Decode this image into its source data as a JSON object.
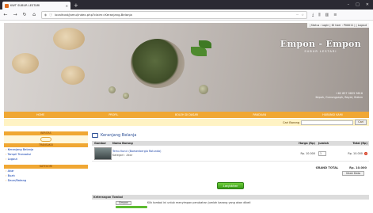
{
  "browser": {
    "tab_title": "KWT SUBUR LESTARI",
    "url": "localhost/jamu/index.php?claim=Keranjang-Belanja",
    "new_tab": "+"
  },
  "header": {
    "status": "| Status : Login | ID User : P00011 | | Logout",
    "brand_name": "Empon - Empon",
    "brand_sub": "SUBUR LESTARI",
    "phone": "+62 857 0825 9616",
    "address": "Kepoh, Gunungpaph, Bayat, Klaten"
  },
  "nav": [
    "HOME",
    "PROFIL",
    "BOLEH DI DASAR",
    "PANDUAN",
    "HUBUNGI KAMI"
  ],
  "cart_search": {
    "label": "Cari Barang",
    "button": "Cari"
  },
  "sidebar": {
    "head1": "BERITAS",
    "head2": "TRANSAKSI",
    "links1": [
      "Keranjang Belanja",
      "Tampil Transaksi",
      "Logout"
    ],
    "head3": "KATEGORI",
    "links2": [
      "Akar",
      "Buah",
      "Daun/Batang"
    ]
  },
  "content": {
    "title": "Keranjang Belanja",
    "columns": [
      "Gambar",
      "Nama Barang",
      "Harga (Rp)",
      "Jumlah",
      "Total (Rp)"
    ],
    "items": [
      {
        "name": "Temu Kunci (Boesenbergia Rotunda)",
        "category": "Kategori : Akar",
        "price": "Rp. 10.000",
        "qty": "1",
        "total": "Rp. 10.000"
      }
    ],
    "grand_total_label": "GRAND TOTAL",
    "grand_total": "Rp. 10.000",
    "update_label": "Ubah Data",
    "checkout_label": "Lanjutkan",
    "legend_title": "Keterangan Tombol",
    "legend_button": "Simpan",
    "legend_text": "Klik tombol ini untuk menyimpan perubahan jumlah barang yang akan dibeli"
  }
}
